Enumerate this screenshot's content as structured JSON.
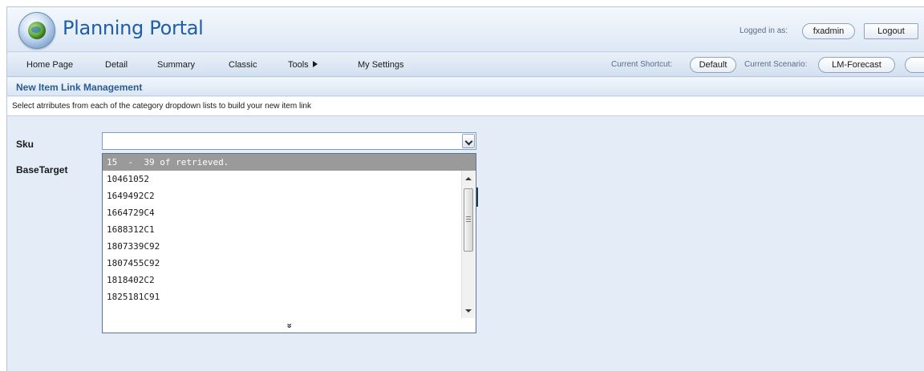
{
  "header": {
    "app_title": "Planning Portal",
    "logged_in_label": "Logged in as:",
    "username": "fxadmin",
    "logout_label": "Logout"
  },
  "nav": {
    "items": [
      {
        "label": "Home Page"
      },
      {
        "label": "Detail"
      },
      {
        "label": "Summary"
      },
      {
        "label": "Classic"
      },
      {
        "label": "Tools"
      },
      {
        "label": "My Settings"
      }
    ],
    "current_shortcut_label": "Current Shortcut:",
    "current_shortcut_value": "Default",
    "current_scenario_label": "Current Scenario:",
    "current_scenario_value": "LM-Forecast"
  },
  "page": {
    "section_title": "New Item Link Management",
    "instruction": "Select atrributes from each of the category dropdown lists to build your new item link"
  },
  "form": {
    "sku_label": "Sku",
    "sku_value": "",
    "basetarget_label": "BaseTarget"
  },
  "dropdown": {
    "header": "15  -  39 of retrieved.",
    "items": [
      "10461052",
      "1649492C2",
      "1664729C4",
      "1688312C1",
      "1807339C92",
      "1807455C92",
      "1818402C2",
      "1825181C91"
    ],
    "more_glyph": "»"
  },
  "icons": {
    "logo": "globe-logo-icon",
    "tools_submenu": "triangle-right-icon",
    "select_button": "chevron-down-icon",
    "more": "double-chevron-down-icon"
  }
}
